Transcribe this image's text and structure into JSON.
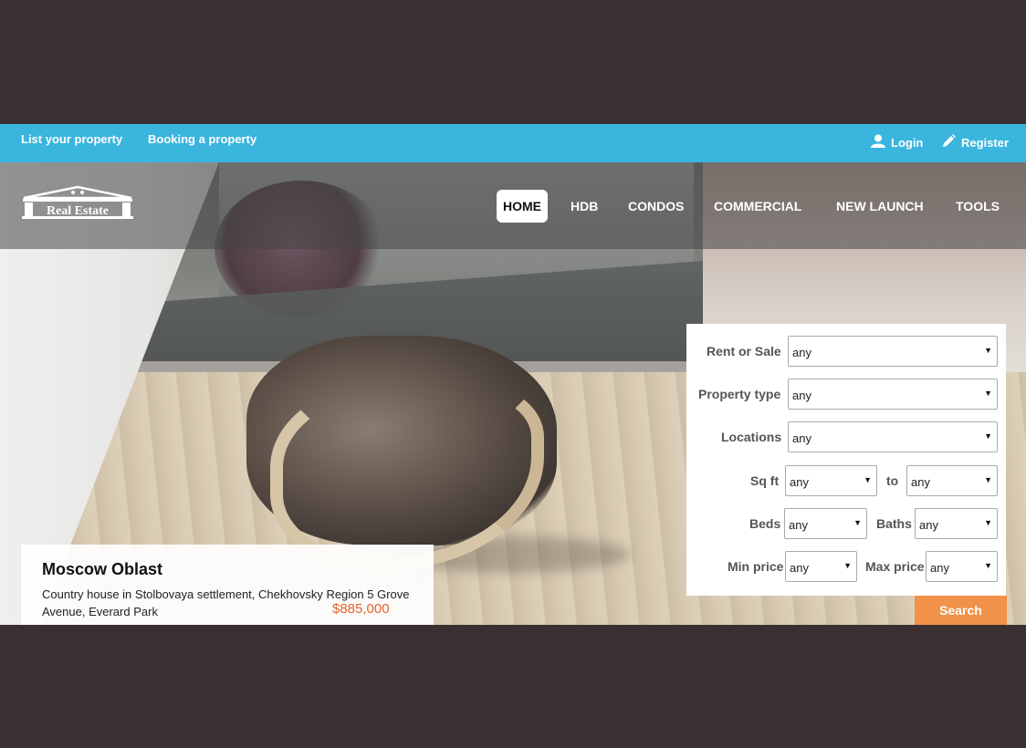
{
  "topbar": {
    "list_property": "List your property",
    "booking_property": "Booking a property",
    "login": "Login",
    "register": "Register"
  },
  "logo": {
    "text": "Real Estate"
  },
  "nav": {
    "items": [
      {
        "label": "HOME",
        "active": true
      },
      {
        "label": "HDB"
      },
      {
        "label": "CONDOS"
      },
      {
        "label": "COMMERCIAL"
      },
      {
        "label": "NEW LAUNCH"
      },
      {
        "label": "TOOLS"
      }
    ]
  },
  "search": {
    "rent_or_sale_label": "Rent or Sale",
    "rent_or_sale_value": "any",
    "property_type_label": "Property type",
    "property_type_value": "any",
    "locations_label": "Locations",
    "locations_value": "any",
    "sqft_label": "Sq ft",
    "sqft_from_value": "any",
    "sqft_to_label": "to",
    "sqft_to_value": "any",
    "beds_label": "Beds",
    "beds_value": "any",
    "baths_label": "Baths",
    "baths_value": "any",
    "min_price_label": "Min price",
    "min_price_value": "any",
    "max_price_label": "Max price",
    "max_price_value": "any",
    "button": "Search",
    "arrow": "▼"
  },
  "featured": {
    "title": "Moscow Oblast",
    "description": "Country house in Stolbovaya settlement, Chekhovsky Region 5 Grove Avenue, Everard Park",
    "price": "$885,000"
  },
  "colors": {
    "topbar": "#3ab5dd",
    "search_button": "#f0924a",
    "price": "#e0632f",
    "background": "#3a2f31"
  },
  "icons": [
    "user-icon",
    "pencil-icon",
    "real-estate-logo"
  ]
}
